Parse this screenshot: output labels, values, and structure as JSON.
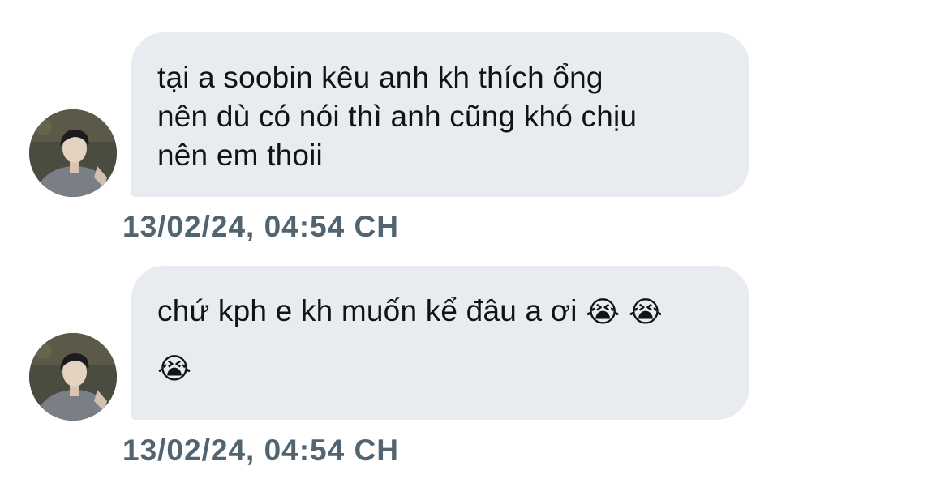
{
  "messages": [
    {
      "lines": [
        "tại a soobin kêu anh kh thích ổng",
        "nên dù có nói thì anh cũng khó chịu",
        "nên em thoii"
      ],
      "timestamp": "13/02/24, 04:54 CH"
    },
    {
      "text": "chứ kph e kh muốn kể đâu a ơi",
      "emojis": [
        "😭",
        "😭",
        "😭"
      ],
      "timestamp": "13/02/24, 04:54 CH"
    }
  ],
  "colors": {
    "bubble_bg": "#e8ecf1",
    "text": "#0f1419",
    "timestamp": "#536471"
  }
}
